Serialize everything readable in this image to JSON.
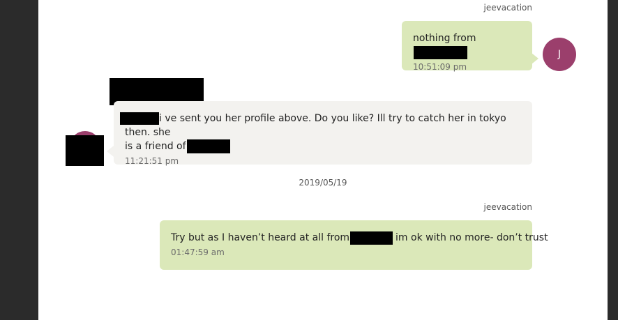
{
  "messages": [
    {
      "sender": "jeevacation",
      "text_before": "nothing from",
      "time": "10:51:09 pm",
      "avatar_initial": "J"
    },
    {
      "text_main": "i ve sent you her profile above. Do you like? Ill try to catch her in tokyo then. she",
      "text_line2": "is a friend of",
      "time": "11:21:51 pm"
    },
    {
      "sender": "jeevacation",
      "text_before": "Try but as I haven’t heard at all from",
      "text_after": "im ok with no more-  don’t trust",
      "time": "01:47:59 am"
    }
  ],
  "date_separator": "2019/05/19",
  "colors": {
    "outgoing_bubble": "#dbe8b9",
    "incoming_bubble": "#f3f2ef",
    "avatar": "#9b3f6c",
    "background_frame": "#2b2b2b"
  }
}
